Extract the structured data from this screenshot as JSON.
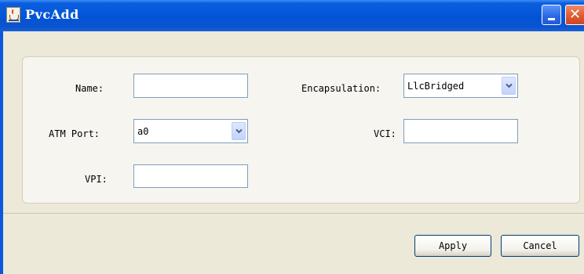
{
  "window": {
    "title": "PvcAdd"
  },
  "form": {
    "name_label": "Name:",
    "name_value": "",
    "atm_port_label": "ATM Port:",
    "atm_port_value": "a0",
    "vpi_label": "VPI:",
    "vpi_value": "",
    "encapsulation_label": "Encapsulation:",
    "encapsulation_value": "LlcBridged",
    "vci_label": "VCI:",
    "vci_value": ""
  },
  "buttons": {
    "apply": "Apply",
    "cancel": "Cancel"
  },
  "icons": {
    "app": "java-cup-icon",
    "minimize": "minimize-icon",
    "close": "close-icon",
    "dropdown": "chevron-down-icon"
  },
  "colors": {
    "titlebar": "#0254d6",
    "client": "#ece9d8",
    "close_button": "#e05a32"
  }
}
